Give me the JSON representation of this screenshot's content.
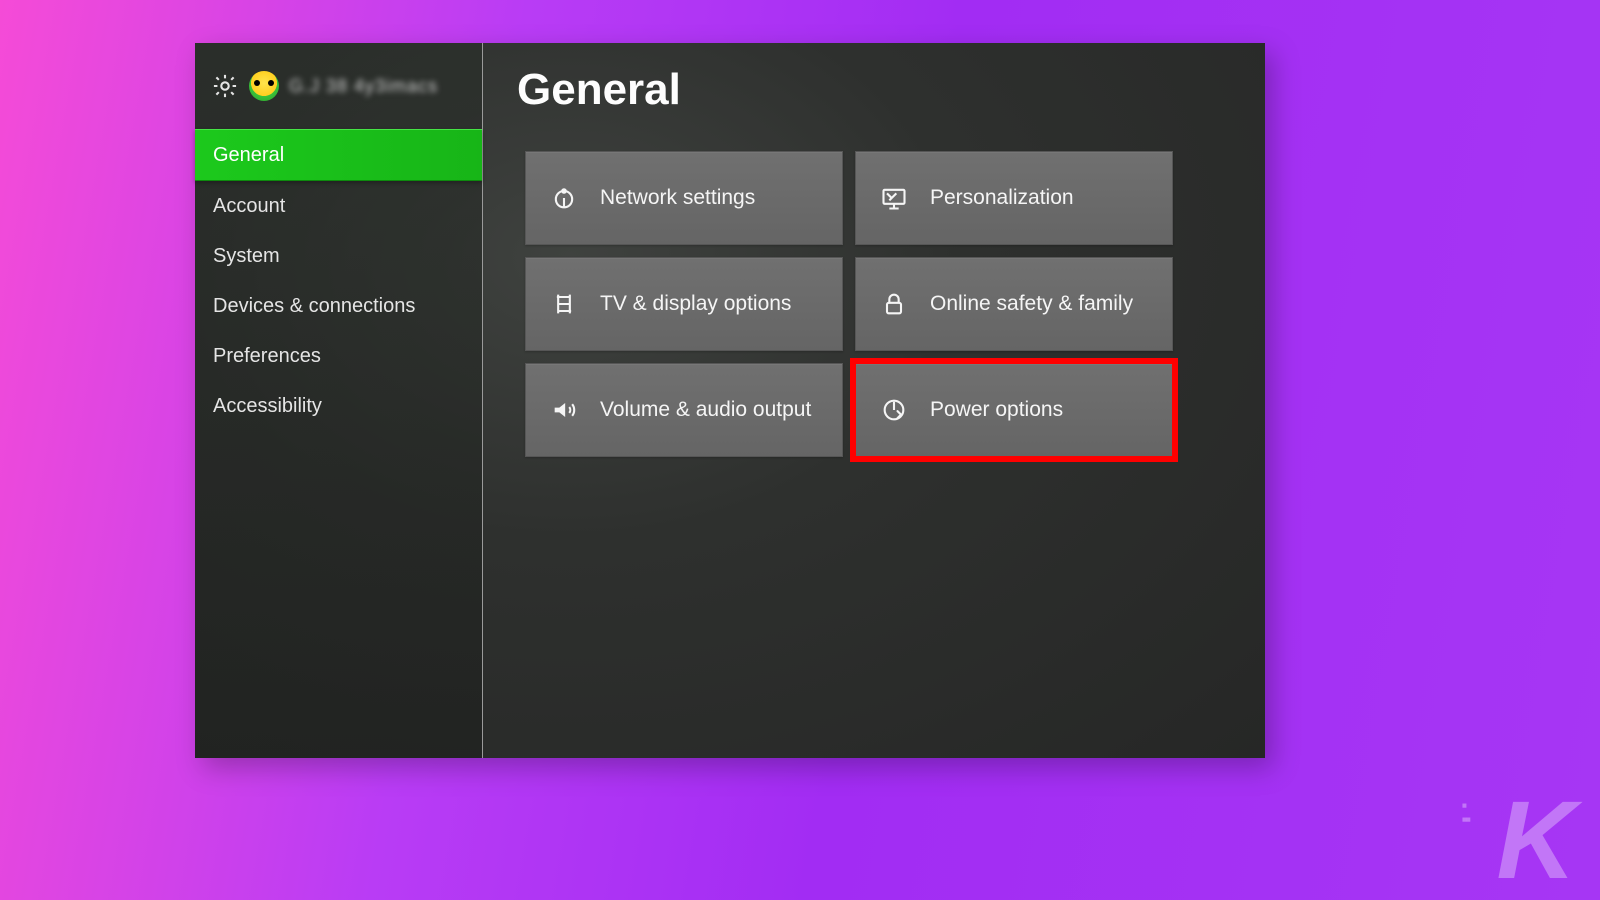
{
  "header": {
    "gamertag_blurred": "G.J 38 4y3imacs"
  },
  "page_title": "General",
  "sidebar": {
    "items": [
      {
        "label": "General",
        "selected": true
      },
      {
        "label": "Account",
        "selected": false
      },
      {
        "label": "System",
        "selected": false
      },
      {
        "label": "Devices & connections",
        "selected": false
      },
      {
        "label": "Preferences",
        "selected": false
      },
      {
        "label": "Accessibility",
        "selected": false
      }
    ]
  },
  "tiles": [
    {
      "label": "Network settings",
      "icon": "network-icon",
      "highlighted": false
    },
    {
      "label": "Personalization",
      "icon": "personalization-icon",
      "highlighted": false
    },
    {
      "label": "TV & display options",
      "icon": "tv-display-icon",
      "highlighted": false
    },
    {
      "label": "Online safety & family",
      "icon": "lock-icon",
      "highlighted": false
    },
    {
      "label": "Volume & audio output",
      "icon": "volume-icon",
      "highlighted": false
    },
    {
      "label": "Power options",
      "icon": "power-icon",
      "highlighted": true
    }
  ],
  "watermark": "K"
}
